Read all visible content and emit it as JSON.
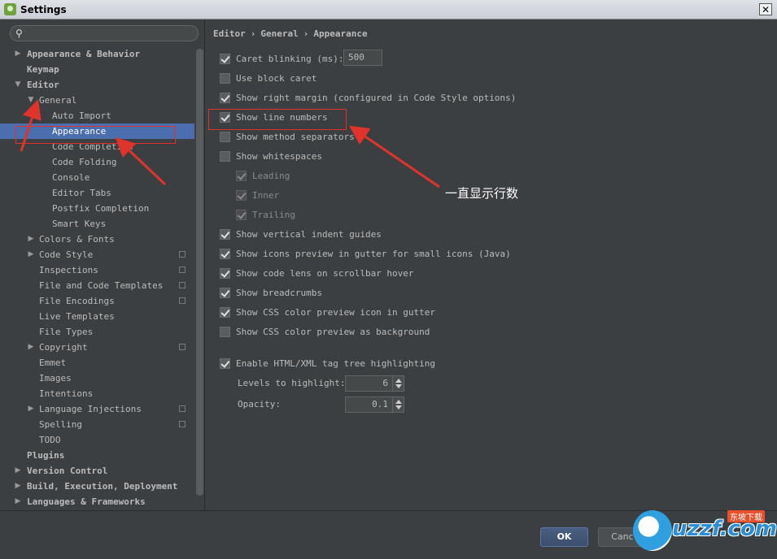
{
  "window": {
    "title": "Settings",
    "close_glyph": "✕"
  },
  "search": {
    "placeholder": ""
  },
  "tree": [
    {
      "label": "Appearance & Behavior",
      "level": 0,
      "arrow": "▶",
      "bold": true
    },
    {
      "label": "Keymap",
      "level": 0,
      "arrow": "",
      "bold": true
    },
    {
      "label": "Editor",
      "level": 0,
      "arrow": "▼",
      "bold": true
    },
    {
      "label": "General",
      "level": 1,
      "arrow": "▼",
      "bold": false
    },
    {
      "label": "Auto Import",
      "level": 2,
      "arrow": "",
      "bold": false
    },
    {
      "label": "Appearance",
      "level": 2,
      "arrow": "",
      "bold": false,
      "selected": true
    },
    {
      "label": "Code Completion",
      "level": 2,
      "arrow": "",
      "bold": false
    },
    {
      "label": "Code Folding",
      "level": 2,
      "arrow": "",
      "bold": false
    },
    {
      "label": "Console",
      "level": 2,
      "arrow": "",
      "bold": false
    },
    {
      "label": "Editor Tabs",
      "level": 2,
      "arrow": "",
      "bold": false
    },
    {
      "label": "Postfix Completion",
      "level": 2,
      "arrow": "",
      "bold": false
    },
    {
      "label": "Smart Keys",
      "level": 2,
      "arrow": "",
      "bold": false
    },
    {
      "label": "Colors & Fonts",
      "level": 1,
      "arrow": "▶",
      "bold": false
    },
    {
      "label": "Code Style",
      "level": 1,
      "arrow": "▶",
      "bold": false,
      "project": true
    },
    {
      "label": "Inspections",
      "level": 1,
      "arrow": "",
      "bold": false,
      "project": true
    },
    {
      "label": "File and Code Templates",
      "level": 1,
      "arrow": "",
      "bold": false,
      "project": true
    },
    {
      "label": "File Encodings",
      "level": 1,
      "arrow": "",
      "bold": false,
      "project": true
    },
    {
      "label": "Live Templates",
      "level": 1,
      "arrow": "",
      "bold": false
    },
    {
      "label": "File Types",
      "level": 1,
      "arrow": "",
      "bold": false
    },
    {
      "label": "Copyright",
      "level": 1,
      "arrow": "▶",
      "bold": false,
      "project": true
    },
    {
      "label": "Emmet",
      "level": 1,
      "arrow": "",
      "bold": false
    },
    {
      "label": "Images",
      "level": 1,
      "arrow": "",
      "bold": false
    },
    {
      "label": "Intentions",
      "level": 1,
      "arrow": "",
      "bold": false
    },
    {
      "label": "Language Injections",
      "level": 1,
      "arrow": "▶",
      "bold": false,
      "project": true
    },
    {
      "label": "Spelling",
      "level": 1,
      "arrow": "",
      "bold": false,
      "project": true
    },
    {
      "label": "TODO",
      "level": 1,
      "arrow": "",
      "bold": false
    },
    {
      "label": "Plugins",
      "level": 0,
      "arrow": "",
      "bold": true
    },
    {
      "label": "Version Control",
      "level": 0,
      "arrow": "▶",
      "bold": true
    },
    {
      "label": "Build, Execution, Deployment",
      "level": 0,
      "arrow": "▶",
      "bold": true
    },
    {
      "label": "Languages & Frameworks",
      "level": 0,
      "arrow": "▶",
      "bold": true
    }
  ],
  "breadcrumb": [
    "Editor",
    "›",
    "General",
    "›",
    "Appearance"
  ],
  "options": {
    "caret_blinking": {
      "label": "Caret blinking (ms):",
      "checked": true,
      "value": "500"
    },
    "block_caret": {
      "label": "Use block caret",
      "checked": false
    },
    "right_margin": {
      "label": "Show right margin (configured in Code Style options)",
      "checked": true
    },
    "line_numbers": {
      "label": "Show line numbers",
      "checked": true
    },
    "method_separators": {
      "label": "Show method separators",
      "checked": false
    },
    "whitespaces": {
      "label": "Show whitespaces",
      "checked": false
    },
    "leading": {
      "label": "Leading",
      "checked": true,
      "disabled": true
    },
    "inner": {
      "label": "Inner",
      "checked": true,
      "disabled": true
    },
    "trailing": {
      "label": "Trailing",
      "checked": true,
      "disabled": true
    },
    "indent_guides": {
      "label": "Show vertical indent guides",
      "checked": true
    },
    "icons_preview": {
      "label": "Show icons preview in gutter for small icons (Java)",
      "checked": true
    },
    "code_lens": {
      "label": "Show code lens on scrollbar hover",
      "checked": true
    },
    "breadcrumbs": {
      "label": "Show breadcrumbs",
      "checked": true
    },
    "css_color_icon": {
      "label": "Show CSS color preview icon in gutter",
      "checked": true
    },
    "css_color_bg": {
      "label": "Show CSS color preview as background",
      "checked": false
    },
    "tag_tree": {
      "label": "Enable HTML/XML tag tree highlighting",
      "checked": true
    },
    "levels": {
      "label": "Levels to highlight:",
      "value": "6"
    },
    "opacity": {
      "label": "Opacity:",
      "value": "0.1"
    }
  },
  "buttons": {
    "ok": "OK",
    "cancel": "Canc"
  },
  "annotation": {
    "text": "一直显示行数",
    "color": "#e0332b"
  },
  "watermark": {
    "text": "uzzf.com",
    "badge": "东坡下载"
  },
  "colors": {
    "selection": "#4b6eaf",
    "background": "#3c3f41"
  }
}
